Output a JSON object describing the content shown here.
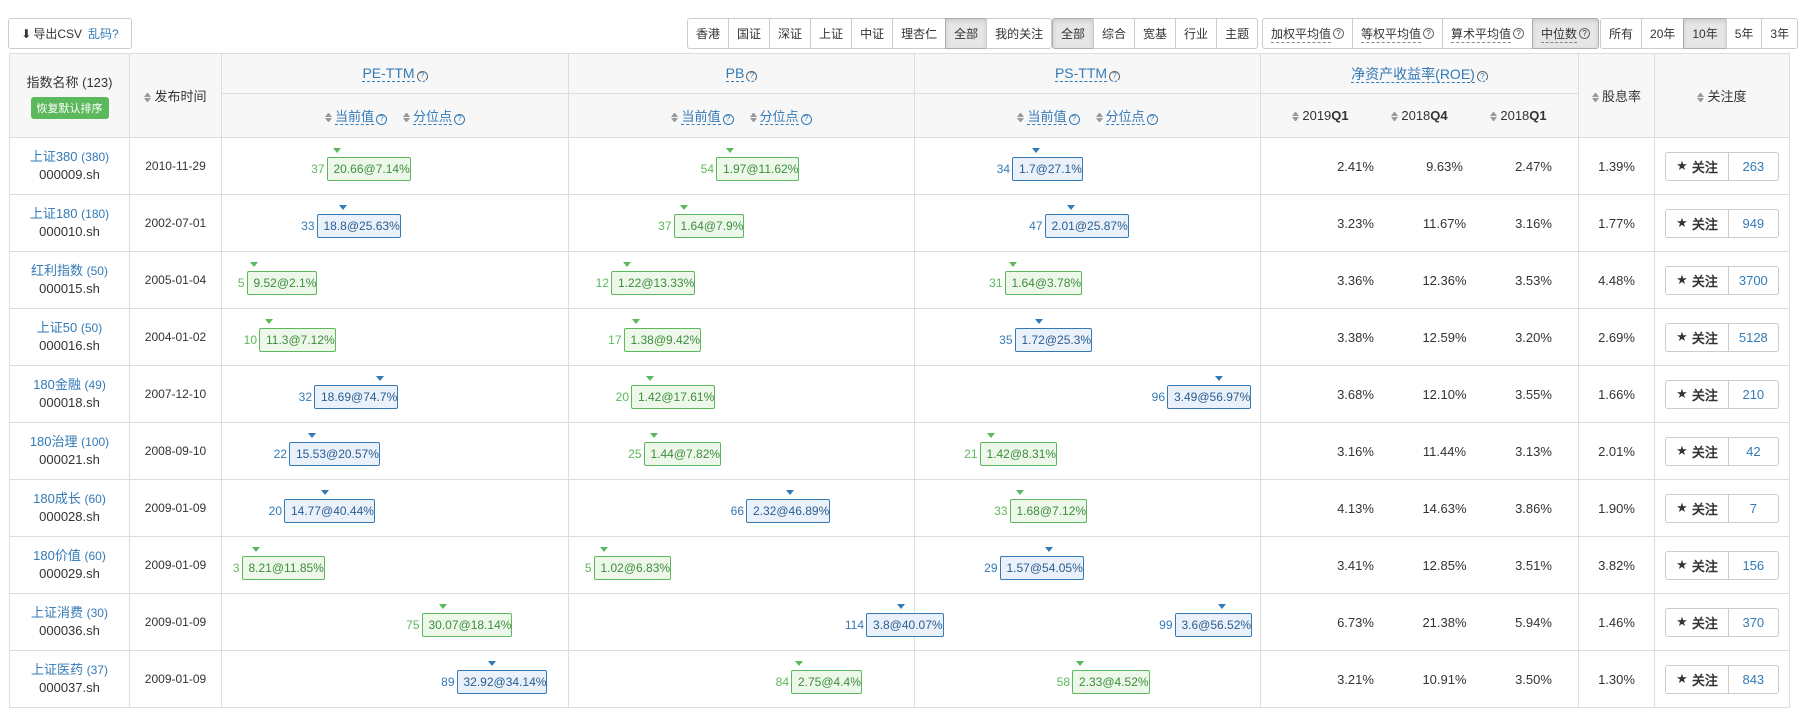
{
  "colors": {
    "accent": "#337ab7",
    "green": "#5cb85c"
  },
  "toolbar": {
    "csv_label": "导出CSV",
    "csv_garble": "乱码?",
    "market_filters": [
      "香港",
      "国证",
      "深证",
      "上证",
      "中证",
      "理杏仁",
      "全部",
      "我的关注"
    ],
    "market_active": 6,
    "type_filters": [
      "全部",
      "综合",
      "宽基",
      "行业",
      "主题"
    ],
    "type_active": 0,
    "avg_filters": [
      "加权平均值",
      "等权平均值",
      "算术平均值",
      "中位数"
    ],
    "avg_active": 3,
    "period_filters": [
      "所有",
      "20年",
      "10年",
      "5年",
      "3年"
    ],
    "period_active": 2
  },
  "table": {
    "name_header": "指数名称 (123)",
    "reset_label": "恢复默认排序",
    "date_header": "发布时间",
    "groups": [
      "PE-TTM",
      "PB",
      "PS-TTM",
      "净资产收益率(ROE)"
    ],
    "current_label": "当前值",
    "percentile_label": "分位点",
    "roe_cols": [
      {
        "year": "2019",
        "q": "Q1"
      },
      {
        "year": "2018",
        "q": "Q4"
      },
      {
        "year": "2018",
        "q": "Q1"
      }
    ],
    "dividend_header": "股息率",
    "follow_header": "关注度",
    "follow_label": "关注",
    "rows": [
      {
        "name": "上证380",
        "count": "(380)",
        "code": "000009.sh",
        "date": "2010-11-29",
        "pe": {
          "level": 37,
          "text": "20.66@7.14%",
          "color": "green"
        },
        "pb": {
          "level": 54,
          "text": "1.97@11.62%",
          "color": "green"
        },
        "ps": {
          "level": 34,
          "text": "1.7@27.1%",
          "color": "blue"
        },
        "roe": [
          "2.41%",
          "9.63%",
          "2.47%"
        ],
        "div": "1.39%",
        "follow": "263"
      },
      {
        "name": "上证180",
        "count": "(180)",
        "code": "000010.sh",
        "date": "2002-07-01",
        "pe": {
          "level": 33,
          "text": "18.8@25.63%",
          "color": "blue"
        },
        "pb": {
          "level": 37,
          "text": "1.64@7.9%",
          "color": "green"
        },
        "ps": {
          "level": 47,
          "text": "2.01@25.87%",
          "color": "blue"
        },
        "roe": [
          "3.23%",
          "11.67%",
          "3.16%"
        ],
        "div": "1.77%",
        "follow": "949"
      },
      {
        "name": "红利指数",
        "count": "(50)",
        "code": "000015.sh",
        "date": "2005-01-04",
        "pe": {
          "level": 5,
          "text": "9.52@2.1%",
          "color": "green"
        },
        "pb": {
          "level": 12,
          "text": "1.22@13.33%",
          "color": "green"
        },
        "ps": {
          "level": 31,
          "text": "1.64@3.78%",
          "color": "green"
        },
        "roe": [
          "3.36%",
          "12.36%",
          "3.53%"
        ],
        "div": "4.48%",
        "follow": "3700"
      },
      {
        "name": "上证50",
        "count": "(50)",
        "code": "000016.sh",
        "date": "2004-01-02",
        "pe": {
          "level": 10,
          "text": "11.3@7.12%",
          "color": "green"
        },
        "pb": {
          "level": 17,
          "text": "1.38@9.42%",
          "color": "green"
        },
        "ps": {
          "level": 35,
          "text": "1.72@25.3%",
          "color": "blue"
        },
        "roe": [
          "3.38%",
          "12.59%",
          "3.20%"
        ],
        "div": "2.69%",
        "follow": "5128"
      },
      {
        "name": "180金融",
        "count": "(49)",
        "code": "000018.sh",
        "date": "2007-12-10",
        "pe": {
          "level": 32,
          "text": "18.69@74.7%",
          "color": "blue"
        },
        "pb": {
          "level": 20,
          "text": "1.42@17.61%",
          "color": "green"
        },
        "ps": {
          "level": 96,
          "text": "3.49@56.97%",
          "color": "blue"
        },
        "roe": [
          "3.68%",
          "12.10%",
          "3.55%"
        ],
        "div": "1.66%",
        "follow": "210"
      },
      {
        "name": "180治理",
        "count": "(100)",
        "code": "000021.sh",
        "date": "2008-09-10",
        "pe": {
          "level": 22,
          "text": "15.53@20.57%",
          "color": "blue"
        },
        "pb": {
          "level": 25,
          "text": "1.44@7.82%",
          "color": "green"
        },
        "ps": {
          "level": 21,
          "text": "1.42@8.31%",
          "color": "green"
        },
        "roe": [
          "3.16%",
          "11.44%",
          "3.13%"
        ],
        "div": "2.01%",
        "follow": "42"
      },
      {
        "name": "180成长",
        "count": "(60)",
        "code": "000028.sh",
        "date": "2009-01-09",
        "pe": {
          "level": 20,
          "text": "14.77@40.44%",
          "color": "blue"
        },
        "pb": {
          "level": 66,
          "text": "2.32@46.89%",
          "color": "blue"
        },
        "ps": {
          "level": 33,
          "text": "1.68@7.12%",
          "color": "green"
        },
        "roe": [
          "4.13%",
          "14.63%",
          "3.86%"
        ],
        "div": "1.90%",
        "follow": "7"
      },
      {
        "name": "180价值",
        "count": "(60)",
        "code": "000029.sh",
        "date": "2009-01-09",
        "pe": {
          "level": 3,
          "text": "8.21@11.85%",
          "color": "green"
        },
        "pb": {
          "level": 5,
          "text": "1.02@6.83%",
          "color": "green"
        },
        "ps": {
          "level": 29,
          "text": "1.57@54.05%",
          "color": "blue"
        },
        "roe": [
          "3.41%",
          "12.85%",
          "3.51%"
        ],
        "div": "3.82%",
        "follow": "156"
      },
      {
        "name": "上证消费",
        "count": "(30)",
        "code": "000036.sh",
        "date": "2009-01-09",
        "pe": {
          "level": 75,
          "text": "30.07@18.14%",
          "color": "green"
        },
        "pb": {
          "level": 114,
          "text": "3.8@40.07%",
          "color": "blue"
        },
        "ps": {
          "level": 99,
          "text": "3.6@56.52%",
          "color": "blue"
        },
        "roe": [
          "6.73%",
          "21.38%",
          "5.94%"
        ],
        "div": "1.46%",
        "follow": "370"
      },
      {
        "name": "上证医药",
        "count": "(37)",
        "code": "000037.sh",
        "date": "2009-01-09",
        "pe": {
          "level": 89,
          "text": "32.92@34.14%",
          "color": "blue"
        },
        "pb": {
          "level": 84,
          "text": "2.75@4.4%",
          "color": "green"
        },
        "ps": {
          "level": 58,
          "text": "2.33@4.52%",
          "color": "green"
        },
        "roe": [
          "3.21%",
          "10.91%",
          "3.50%"
        ],
        "div": "1.30%",
        "follow": "843"
      }
    ]
  }
}
